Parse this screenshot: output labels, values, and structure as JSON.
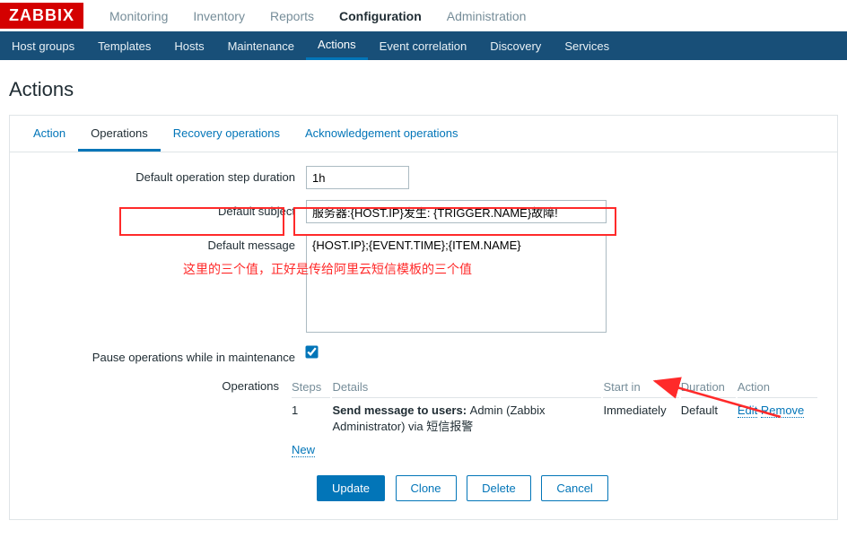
{
  "brand": "ZABBIX",
  "topnav": {
    "items": [
      {
        "label": "Monitoring"
      },
      {
        "label": "Inventory"
      },
      {
        "label": "Reports"
      },
      {
        "label": "Configuration"
      },
      {
        "label": "Administration"
      }
    ]
  },
  "subnav": {
    "items": [
      {
        "label": "Host groups"
      },
      {
        "label": "Templates"
      },
      {
        "label": "Hosts"
      },
      {
        "label": "Maintenance"
      },
      {
        "label": "Actions"
      },
      {
        "label": "Event correlation"
      },
      {
        "label": "Discovery"
      },
      {
        "label": "Services"
      }
    ]
  },
  "page": {
    "title": "Actions"
  },
  "tabs": {
    "items": [
      {
        "label": "Action"
      },
      {
        "label": "Operations"
      },
      {
        "label": "Recovery operations"
      },
      {
        "label": "Acknowledgement operations"
      }
    ]
  },
  "form": {
    "duration_label": "Default operation step duration",
    "duration_value": "1h",
    "subject_label": "Default subject",
    "subject_value": "服务器:{HOST.IP}发生: {TRIGGER.NAME}故障!",
    "message_label": "Default message",
    "message_value": "{HOST.IP};{EVENT.TIME};{ITEM.NAME}",
    "pause_label": "Pause operations while in maintenance",
    "operations_label": "Operations"
  },
  "ops": {
    "headers": {
      "steps": "Steps",
      "details": "Details",
      "startin": "Start in",
      "duration": "Duration",
      "action": "Action"
    },
    "row": {
      "steps": "1",
      "prefix": "Send message to users: ",
      "detail": "Admin (Zabbix Administrator) via 短信报警",
      "startin": "Immediately",
      "duration": "Default",
      "edit": "Edit",
      "remove": "Remove"
    },
    "new": "New"
  },
  "buttons": {
    "update": "Update",
    "clone": "Clone",
    "delete": "Delete",
    "cancel": "Cancel"
  },
  "annotation": {
    "note": "这里的三个值，正好是传给阿里云短信模板的三个值"
  }
}
